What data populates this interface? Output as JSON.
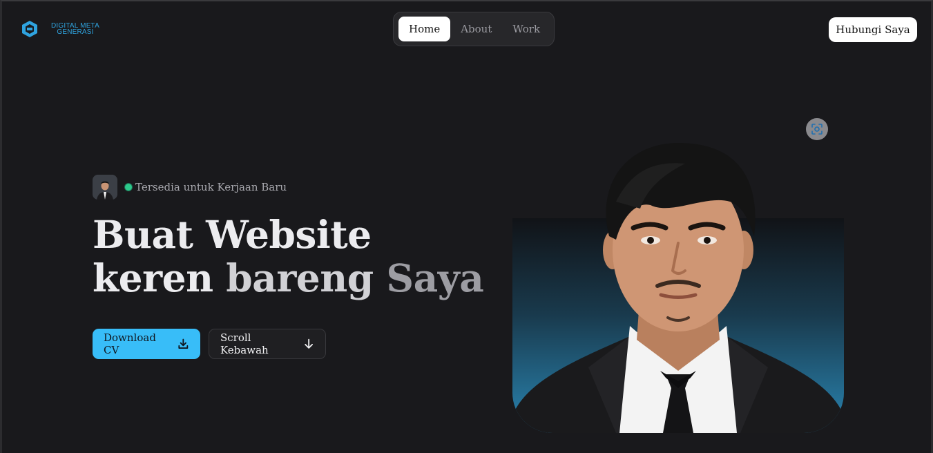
{
  "brand": {
    "line1": "DIGITAL META",
    "line2": "GENERASI",
    "accent_color": "#2fa3df",
    "icon": "hexagon-logo-icon"
  },
  "nav": {
    "items": [
      {
        "label": "Home",
        "active": true
      },
      {
        "label": "About",
        "active": false
      },
      {
        "label": "Work",
        "active": false
      }
    ]
  },
  "header": {
    "contact_label": "Hubungi Saya"
  },
  "hero": {
    "status_text": "Tersedia untuk Kerjaan Baru",
    "status_color": "#2cc98b",
    "title_line1": "Buat Website",
    "title_line2_a": "keren ",
    "title_line2_b": "bareng ",
    "title_line2_c": "Saya",
    "download_label": "Download CV",
    "download_icon": "download-icon",
    "scroll_label": "Scroll Kebawah",
    "scroll_icon": "arrow-down-icon",
    "primary_color": "#38bdf8"
  },
  "photo": {
    "scan_icon": "focus-scan-icon"
  }
}
